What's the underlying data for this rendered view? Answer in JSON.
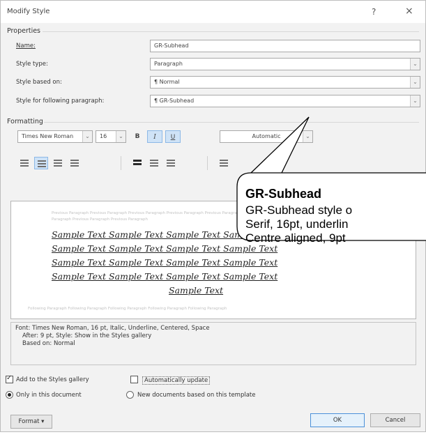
{
  "dialog": {
    "title": "Modify Style",
    "help_glyph": "?",
    "close_glyph": "×"
  },
  "properties": {
    "header": "Properties",
    "name_label": "Name:",
    "name_value": "GR-Subhead",
    "style_type_label": "Style type:",
    "style_type_value": "Paragraph",
    "based_on_label": "Style based on:",
    "based_on_value": "¶  Normal",
    "following_label": "Style for following paragraph:",
    "following_value": "¶  GR-Subhead"
  },
  "formatting": {
    "header": "Formatting",
    "font": "Times New Roman",
    "size": "16",
    "bold": "B",
    "italic": "I",
    "underline": "U",
    "color": "Automatic",
    "italic_active": true,
    "underline_active": true
  },
  "preview": {
    "previous_paragraph": "Previous Paragraph Previous Paragraph Previous Paragraph Previous Paragraph Previous Paragraph",
    "previous_paragraph_2": "Paragraph Previous Paragraph Previous Paragraph",
    "sample_lines": [
      "Sample Text Sample Text Sample Text Sample Text",
      "Sample Text Sample Text Sample Text Sample Text",
      "Sample Text Sample Text Sample Text Sample Text",
      "Sample Text Sample Text Sample Text Sample Text",
      "Sample Text"
    ],
    "following_paragraph": "Following Paragraph Following Paragraph Following Paragraph Following Paragraph Following Paragraph"
  },
  "description": {
    "line1": "Font: Times New Roman, 16 pt, Italic, Underline, Centered, Space",
    "line2": "After:  9 pt, Style: Show in the Styles gallery",
    "line3": "Based on: Normal"
  },
  "options": {
    "add_to_gallery": "Add to the Styles gallery",
    "auto_update": "Automatically update",
    "only_this_doc": "Only in this document",
    "new_docs": "New documents based on this template"
  },
  "buttons": {
    "format": "Format ▾",
    "ok": "OK",
    "cancel": "Cancel"
  },
  "callout": {
    "title": "GR-Subhead",
    "line1": "GR-Subhead style o",
    "line2": "Serif, 16pt, underlin",
    "line3": "Centre aligned, 9pt"
  }
}
